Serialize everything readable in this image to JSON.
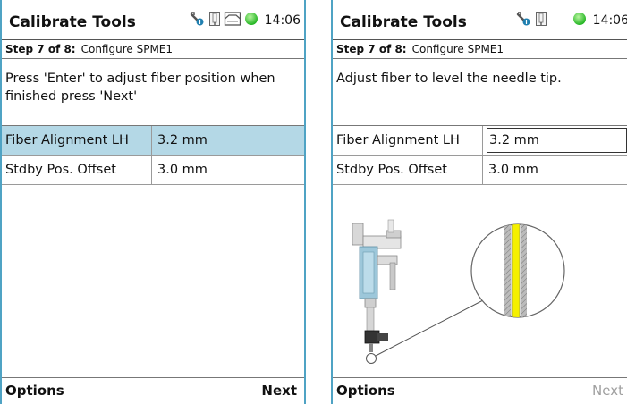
{
  "colors": {
    "frame": "#4fa3c4",
    "selected_row": "#b4d8e6",
    "status_ok": "#33cc33",
    "disabled_text": "#a0a0a0",
    "fiber_yellow": "#f5f000",
    "level_line": "#e06b6b"
  },
  "screens": [
    {
      "title": "Calibrate Tools",
      "time": "14:06",
      "status_icons": [
        "tool-icon",
        "syringe-icon",
        "tray-icon",
        "status-ok-icon"
      ],
      "step_label": "Step 7 of 8:",
      "step_name": "Configure SPME1",
      "instruction": "Press 'Enter' to adjust fiber position when finished press 'Next'",
      "params": [
        {
          "name": "Fiber Alignment LH",
          "value": "3.2 mm"
        },
        {
          "name": "Stdby Pos. Offset",
          "value": "3.0 mm"
        }
      ],
      "softkey_left": "Options",
      "softkey_right": "Next"
    },
    {
      "title": "Calibrate Tools",
      "time": "14:06",
      "status_icons": [
        "tool-icon",
        "syringe-icon",
        "status-ok-icon"
      ],
      "step_label": "Step 7 of 8:",
      "step_name": "Configure SPME1",
      "instruction": "Adjust fiber to level the needle tip.",
      "params": [
        {
          "name": "Fiber Alignment LH",
          "value": "3.2 mm"
        },
        {
          "name": "Stdby Pos. Offset",
          "value": "3.0 mm"
        }
      ],
      "softkey_left": "Options",
      "softkey_right": "Next",
      "illustration": "spme-fiber-alignment-diagram"
    }
  ]
}
